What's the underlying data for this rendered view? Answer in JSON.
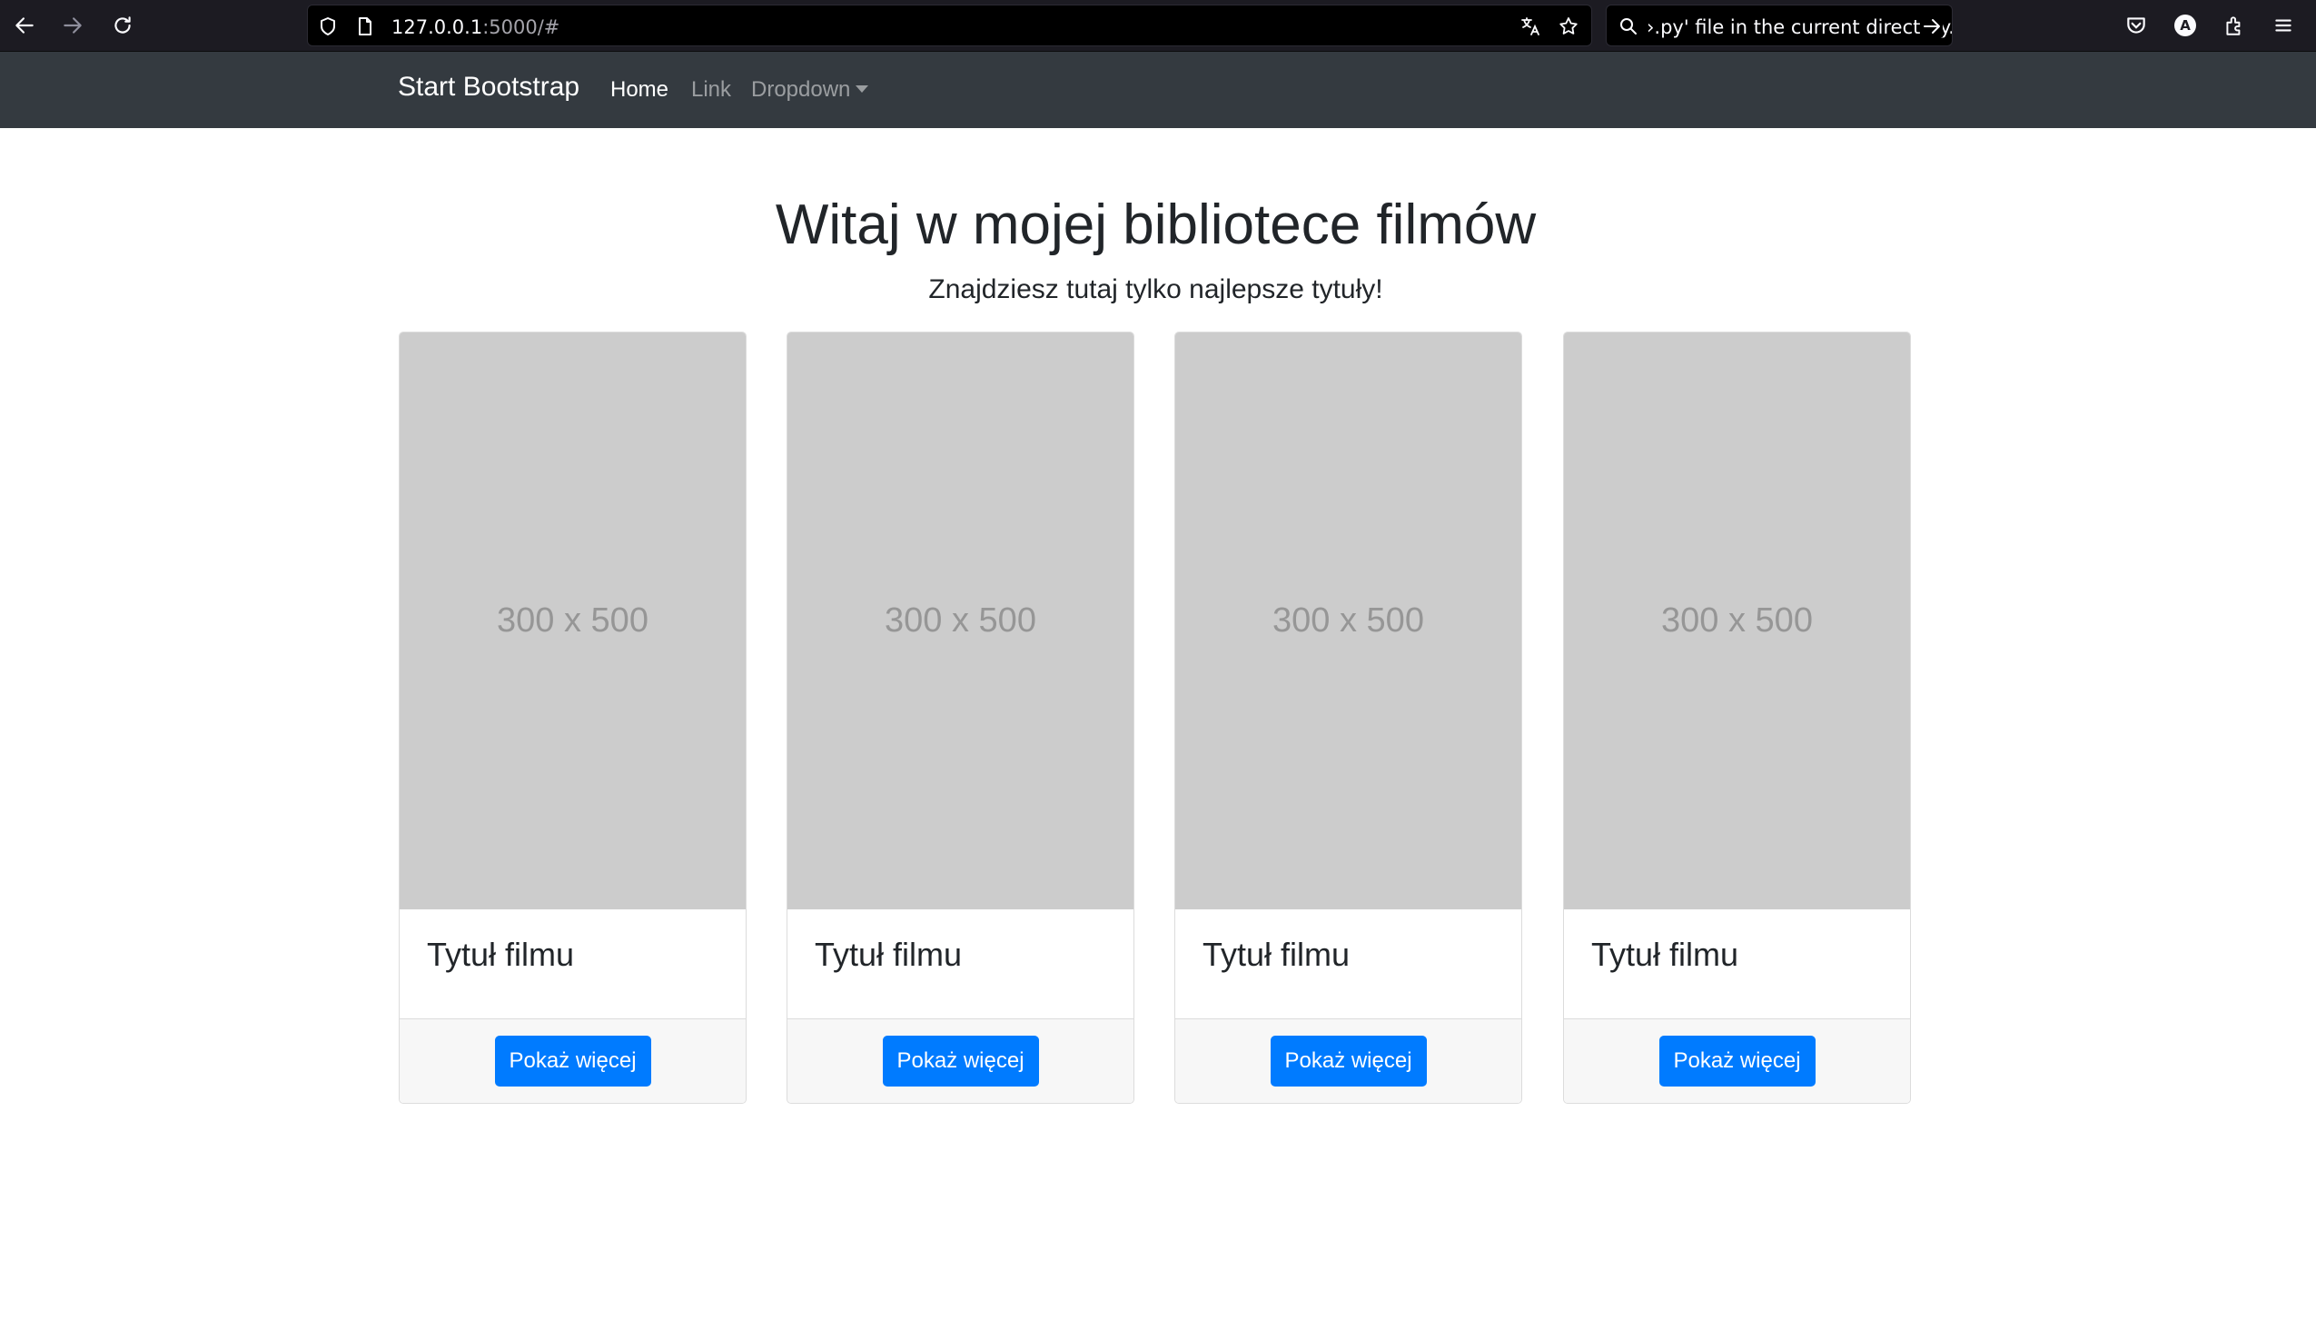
{
  "browser": {
    "url_host": "127.0.0.1",
    "url_rest": ":5000/#",
    "search_text": "›.py' file in the current directory.",
    "icons": [
      "back-icon",
      "forward-icon",
      "reload-icon",
      "shield-icon",
      "page-icon",
      "translate-icon",
      "star-icon",
      "search-icon",
      "go-arrow-icon",
      "pocket-icon",
      "account-icon",
      "extensions-icon",
      "menu-icon"
    ],
    "account_letter": "A"
  },
  "navbar": {
    "brand": "Start Bootstrap",
    "links": [
      {
        "label": "Home",
        "active": true
      },
      {
        "label": "Link",
        "active": false
      },
      {
        "label": "Dropdown",
        "active": false
      }
    ]
  },
  "hero": {
    "title": "Witaj w mojej bibliotece filmów",
    "subtitle": "Znajdziesz tutaj tylko najlepsze tytuły!"
  },
  "cards": [
    {
      "image_text": "300 x 500",
      "title": "Tytuł filmu",
      "button": "Pokaż więcej"
    },
    {
      "image_text": "300 x 500",
      "title": "Tytuł filmu",
      "button": "Pokaż więcej"
    },
    {
      "image_text": "300 x 500",
      "title": "Tytuł filmu",
      "button": "Pokaż więcej"
    },
    {
      "image_text": "300 x 500",
      "title": "Tytuł filmu",
      "button": "Pokaż więcej"
    }
  ],
  "colors": {
    "navbar_bg": "#343a40",
    "primary": "#007bff",
    "placeholder_bg": "#cccccc"
  }
}
